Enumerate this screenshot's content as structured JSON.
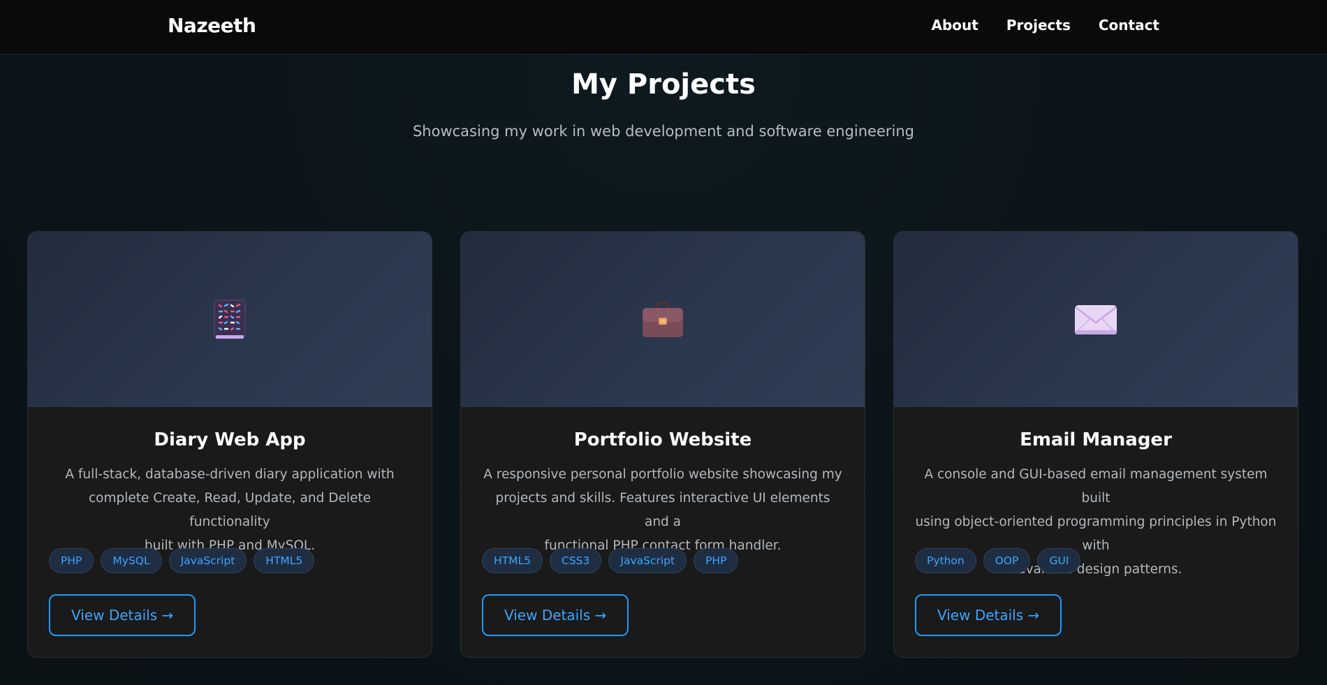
{
  "nav": {
    "brand": "Nazeeth",
    "links": [
      "About",
      "Projects",
      "Contact"
    ]
  },
  "hero": {
    "title": "My Projects",
    "subtitle": "Showcasing my work in web development and software engineering"
  },
  "projects": [
    {
      "icon": "notebook-icon",
      "title": "Diary Web App",
      "desc_lines": [
        "A full-stack, database-driven diary application with",
        "complete Create, Read, Update, and Delete functionality",
        "built with PHP and MySQL."
      ],
      "tags": [
        "PHP",
        "MySQL",
        "JavaScript",
        "HTML5"
      ],
      "button": "View Details →"
    },
    {
      "icon": "briefcase-icon",
      "title": "Portfolio Website",
      "desc_lines": [
        "A responsive personal portfolio website showcasing my",
        "projects and skills. Features interactive UI elements and a",
        "functional PHP contact form handler."
      ],
      "tags": [
        "HTML5",
        "CSS3",
        "JavaScript",
        "PHP"
      ],
      "button": "View Details →"
    },
    {
      "icon": "envelope-icon",
      "title": "Email Manager",
      "desc_lines": [
        "A console and GUI-based email management system built",
        "using object-oriented programming principles in Python with",
        "advanced design patterns."
      ],
      "tags": [
        "Python",
        "OOP",
        "GUI"
      ],
      "button": "View Details →"
    }
  ],
  "colors": {
    "accent": "#1e9bff",
    "card_bg": "#1a1a1a",
    "nav_bg": "#0a0a0a"
  }
}
